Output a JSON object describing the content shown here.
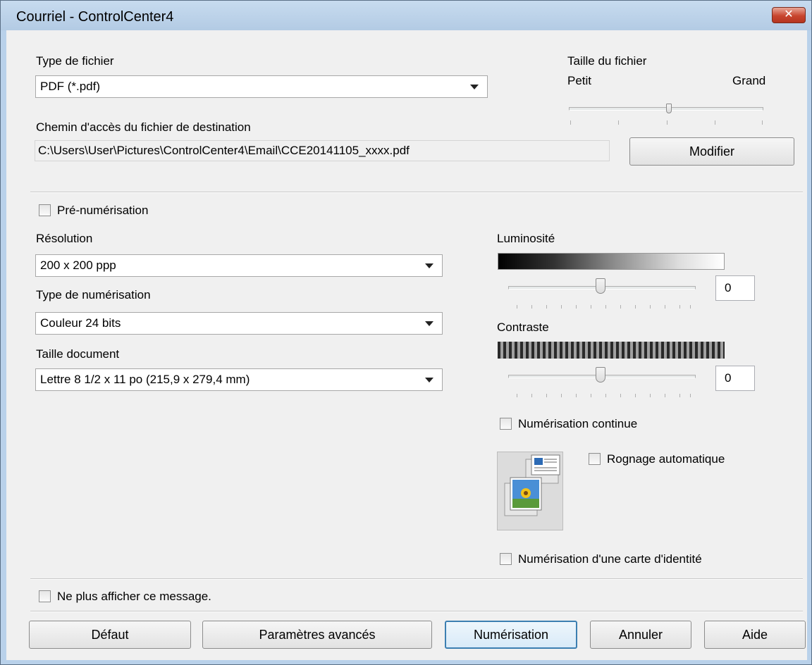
{
  "window": {
    "title": "Courriel - ControlCenter4",
    "close_label": "✕"
  },
  "file": {
    "type_label": "Type de fichier",
    "type_value": "PDF (*.pdf)",
    "size_label": "Taille du fichier",
    "size_small": "Petit",
    "size_large": "Grand",
    "path_label": "Chemin d'accès du fichier de destination",
    "path_value": "C:\\Users\\User\\Pictures\\ControlCenter4\\Email\\CCE20141105_xxxx.pdf",
    "modify_button": "Modifier"
  },
  "scan": {
    "prescan_label": "Pré-numérisation",
    "resolution_label": "Résolution",
    "resolution_value": "200 x 200 ppp",
    "scan_type_label": "Type de numérisation",
    "scan_type_value": "Couleur 24 bits",
    "doc_size_label": "Taille document",
    "doc_size_value": "Lettre 8 1/2 x 11 po (215,9 x 279,4 mm)",
    "brightness_label": "Luminosité",
    "brightness_value": "0",
    "contrast_label": "Contraste",
    "contrast_value": "0",
    "continuous_label": "Numérisation continue",
    "autocrop_label": "Rognage automatique",
    "idcard_label": "Numérisation d'une carte d'identité"
  },
  "footer": {
    "dont_show_label": "Ne plus afficher ce message.",
    "buttons": {
      "default": "Défaut",
      "advanced": "Paramètres avancés",
      "scan": "Numérisation",
      "cancel": "Annuler",
      "help": "Aide"
    }
  }
}
